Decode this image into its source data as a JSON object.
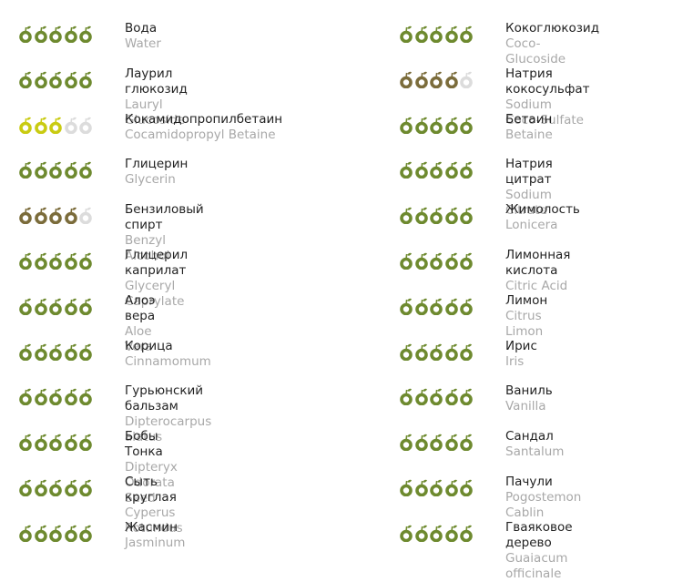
{
  "colors": {
    "green": "#6e8a2f",
    "yellow": "#c9cb12",
    "brown": "#7b6c3b",
    "empty": "#dcdcdc"
  },
  "left": [
    {
      "ru": "Вода",
      "lat": "Water",
      "rating": 5,
      "color": "green"
    },
    {
      "ru": "Лаурил глюкозид",
      "lat": "Lauryl Glucoside",
      "rating": 5,
      "color": "green"
    },
    {
      "ru": "Кокамидопропилбетаин",
      "lat": "Cocamidopropyl Betaine",
      "rating": 3,
      "color": "yellow"
    },
    {
      "ru": "Глицерин",
      "lat": "Glycerin",
      "rating": 5,
      "color": "green"
    },
    {
      "ru": "Бензиловый спирт",
      "lat": "Benzyl Alcohol",
      "rating": 4,
      "color": "brown"
    },
    {
      "ru": "Глицерил каприлат",
      "lat": "Glyceryl Caprylate",
      "rating": 5,
      "color": "green"
    },
    {
      "ru": "Алоэ вера",
      "lat": "Aloe Vera",
      "rating": 5,
      "color": "green"
    },
    {
      "ru": "Корица",
      "lat": "Cinnamomum",
      "rating": 5,
      "color": "green"
    },
    {
      "ru": "Гурьюнский бальзам",
      "lat": "Dipterocarpus alatus",
      "rating": 5,
      "color": "green"
    },
    {
      "ru": "Бобы Тонка",
      "lat": "Dipteryx Odorata Seed",
      "rating": 5,
      "color": "green"
    },
    {
      "ru": "Сыть круглая",
      "lat": "Cyperus Rotundus",
      "rating": 5,
      "color": "green"
    },
    {
      "ru": "Жасмин",
      "lat": "Jasminum",
      "rating": 5,
      "color": "green"
    }
  ],
  "right": [
    {
      "ru": "Кокоглюкозид",
      "lat": "Coco-Glucoside",
      "rating": 5,
      "color": "green"
    },
    {
      "ru": "Натрия кокосульфат",
      "lat": "Sodium Coco-Sulfate",
      "rating": 4,
      "color": "brown"
    },
    {
      "ru": "Бетаин",
      "lat": "Betaine",
      "rating": 5,
      "color": "green"
    },
    {
      "ru": "Натрия цитрат",
      "lat": "Sodium Citrate",
      "rating": 5,
      "color": "green"
    },
    {
      "ru": "Жимолость",
      "lat": "Lonicera",
      "rating": 5,
      "color": "green"
    },
    {
      "ru": "Лимонная кислота",
      "lat": "Citric Acid",
      "rating": 5,
      "color": "green"
    },
    {
      "ru": "Лимон",
      "lat": "Citrus Limon",
      "rating": 5,
      "color": "green"
    },
    {
      "ru": "Ирис",
      "lat": "Iris",
      "rating": 5,
      "color": "green"
    },
    {
      "ru": "Ваниль",
      "lat": "Vanilla",
      "rating": 5,
      "color": "green"
    },
    {
      "ru": "Сандал",
      "lat": "Santalum",
      "rating": 5,
      "color": "green"
    },
    {
      "ru": "Пачули",
      "lat": "Pogostemon Cablin",
      "rating": 5,
      "color": "green"
    },
    {
      "ru": "Гваяковое дерево",
      "lat": "Guaiacum officinale",
      "rating": 5,
      "color": "green"
    }
  ]
}
